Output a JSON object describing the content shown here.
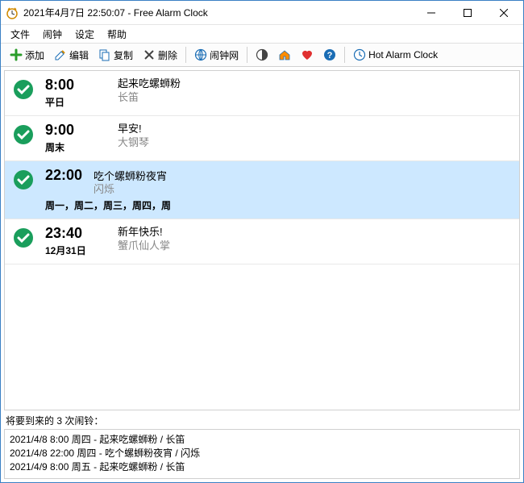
{
  "window": {
    "title": "2021年4月7日 22:50:07 - Free Alarm Clock"
  },
  "menubar": {
    "file": "文件",
    "alarm": "闹钟",
    "settings": "设定",
    "help": "帮助"
  },
  "toolbar": {
    "add": "添加",
    "edit": "编辑",
    "copy": "复制",
    "delete": "删除",
    "website": "闹钟网",
    "hot": "Hot Alarm Clock"
  },
  "alarms": [
    {
      "time": "8:00",
      "days": "平日",
      "title": "起来吃螺蛳粉",
      "sound": "长笛"
    },
    {
      "time": "9:00",
      "days": "周末",
      "title": "早安!",
      "sound": "大钢琴"
    },
    {
      "time": "22:00",
      "days": "周一，周二，周三，周四，周",
      "title": "吃个螺蛳粉夜宵",
      "sound": "闪烁"
    },
    {
      "time": "23:40",
      "days": "12月31日",
      "title": "新年快乐!",
      "sound": "蟹爪仙人掌"
    }
  ],
  "upcoming": {
    "label": "将要到来的 3 次闹铃：",
    "items": [
      "2021/4/8 8:00 周四 - 起来吃螺蛳粉 / 长笛",
      "2021/4/8 22:00 周四 - 吃个螺蛳粉夜宵 / 闪烁",
      "2021/4/9 8:00 周五 - 起来吃螺蛳粉 / 长笛"
    ]
  }
}
